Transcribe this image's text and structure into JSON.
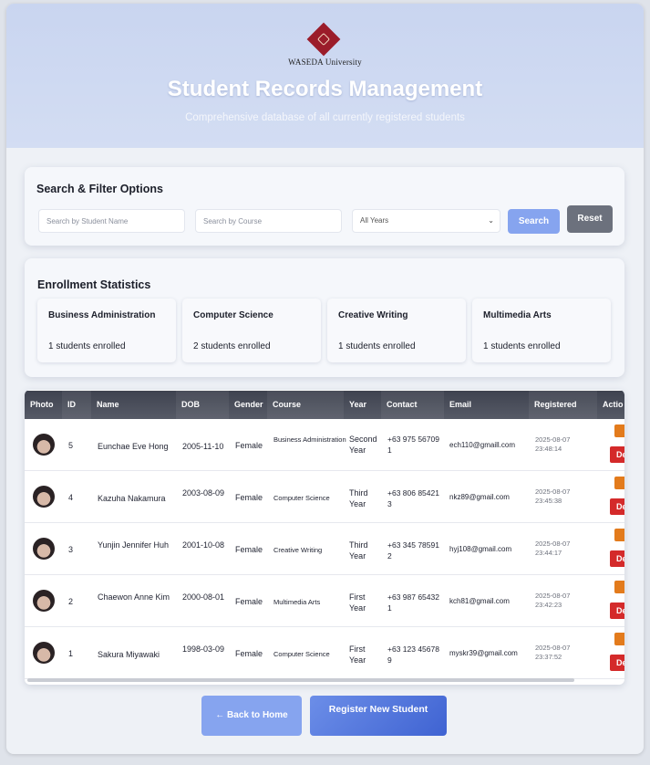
{
  "header": {
    "logo_text": "WASEDA University",
    "title": "Student Records Management",
    "subtitle": "Comprehensive database of all currently registered students"
  },
  "search": {
    "title": "Search & Filter Options",
    "name_placeholder": "Search by Student Name",
    "course_placeholder": "Search by Course",
    "year_selected": "All Years",
    "search_label": "Search",
    "reset_label": "Reset"
  },
  "stats": {
    "title": "Enrollment Statistics",
    "items": [
      {
        "course": "Business Administration",
        "count": "1 students enrolled"
      },
      {
        "course": "Computer Science",
        "count": "2 students enrolled"
      },
      {
        "course": "Creative Writing",
        "count": "1 students enrolled"
      },
      {
        "course": "Multimedia Arts",
        "count": "1 students enrolled"
      }
    ]
  },
  "table": {
    "columns": [
      "Photo",
      "ID",
      "Name",
      "DOB",
      "Gender",
      "Course",
      "Year",
      "Contact",
      "Email",
      "Registered",
      "Actio"
    ],
    "rows": [
      {
        "id": "5",
        "name": "Eunchae Eve Hong",
        "dob": "2005-11-10",
        "gender": "Female",
        "course": "Business Administration",
        "year": "Second Year",
        "contact": "+63 975 567091",
        "email": "ech110@gmaill.com",
        "registered": "2025-08-07 23:48:14"
      },
      {
        "id": "4",
        "name": "Kazuha Nakamura",
        "dob": "2003-08-09",
        "gender": "Female",
        "course": "Computer Science",
        "year": "Third Year",
        "contact": "+63 806 854213",
        "email": "nkz89@gmail.com",
        "registered": "2025-08-07 23:45:38"
      },
      {
        "id": "3",
        "name": "Yunjin Jennifer Huh",
        "dob": "2001-10-08",
        "gender": "Female",
        "course": "Creative Writing",
        "year": "Third Year",
        "contact": "+63 345 785912",
        "email": "hyj108@gmail.com",
        "registered": "2025-08-07 23:44:17"
      },
      {
        "id": "2",
        "name": "Chaewon Anne Kim",
        "dob": "2000-08-01",
        "gender": "Female",
        "course": "Multimedia Arts",
        "year": "First Year",
        "contact": "+63 987 654321",
        "email": "kch81@gmail.com",
        "registered": "2025-08-07 23:42:23"
      },
      {
        "id": "1",
        "name": "Sakura Miyawaki",
        "dob": "1998-03-09",
        "gender": "Female",
        "course": "Computer Science",
        "year": "First Year",
        "contact": "+63 123 456789",
        "email": "myskr39@gmail.com",
        "registered": "2025-08-07 23:37:52"
      }
    ],
    "delete_label": "De"
  },
  "footer": {
    "back_label": "← Back to Home",
    "register_label": "Register New Student"
  },
  "colors": {
    "primary_button": "#86a4ef",
    "reset_button": "#6c717d",
    "edit_button": "#e37b1c",
    "delete_button": "#d42a2a",
    "table_header": "#474b57",
    "logo": "#9b1c2a"
  }
}
